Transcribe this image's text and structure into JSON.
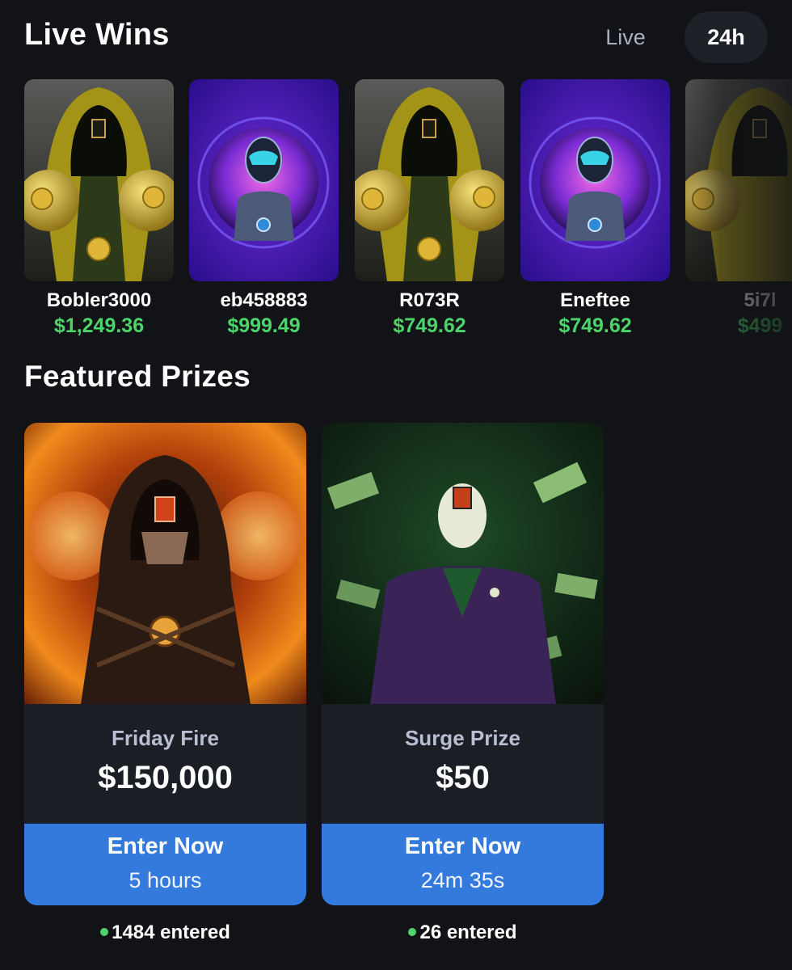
{
  "header": {
    "title": "Live Wins",
    "toggle_live": "Live",
    "toggle_24h": "24h"
  },
  "live_wins": [
    {
      "name": "Bobler3000",
      "amount": "$1,249.36",
      "art": "gold-hooded-boxer-art"
    },
    {
      "name": "eb458883",
      "amount": "$999.49",
      "art": "cyber-astronaut-portal-art"
    },
    {
      "name": "R073R",
      "amount": "$749.62",
      "art": "gold-hooded-boxer-art"
    },
    {
      "name": "Eneftee",
      "amount": "$749.62",
      "art": "cyber-astronaut-portal-art"
    },
    {
      "name": "5i7l",
      "amount": "$499",
      "art": "gold-hooded-boxer-art"
    }
  ],
  "featured": {
    "title": "Featured Prizes",
    "prizes": [
      {
        "label": "Friday Fire",
        "value": "$150,000",
        "cta": "Enter Now",
        "time": "5 hours",
        "entered": "1484 entered",
        "art": "fire-hooded-figure-art"
      },
      {
        "label": "Surge Prize",
        "value": "$50",
        "cta": "Enter Now",
        "time": "24m 35s",
        "entered": "26 entered",
        "art": "green-money-suit-art"
      }
    ]
  },
  "colors": {
    "background": "#111317",
    "card": "#1b1e25",
    "accent_blue": "#3479dc",
    "win_green": "#4cd46a"
  }
}
